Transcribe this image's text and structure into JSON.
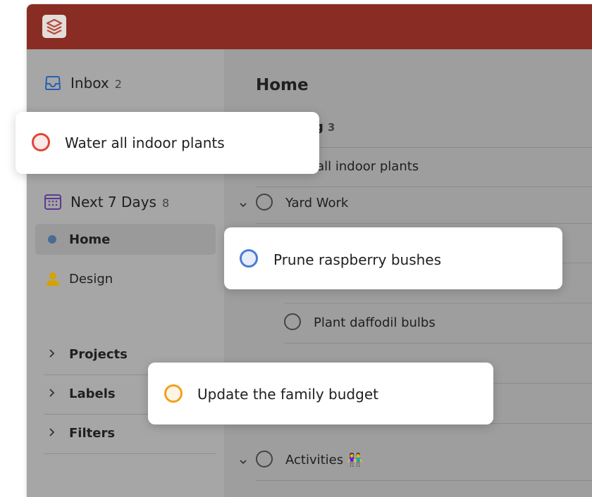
{
  "sidebar": {
    "filters": [
      {
        "label": "Inbox",
        "count": "2"
      },
      {
        "label": "Next 7 Days",
        "count": "8"
      }
    ],
    "projects": [
      {
        "label": "Home",
        "selected": true,
        "color": "#4a6c94"
      },
      {
        "label": "Design",
        "selected": false,
        "color": "#e2b203"
      }
    ],
    "sections": [
      "Projects",
      "Labels",
      "Filters"
    ]
  },
  "main": {
    "title": "Home",
    "sections": [
      {
        "label_tail": "g",
        "count": "3"
      }
    ],
    "rows": [
      {
        "label": "r all indoor plants"
      },
      {
        "label": "Yard Work"
      },
      {
        "label": "Plant daffodil bulbs"
      },
      {
        "label": "Activities 👫"
      }
    ]
  },
  "popups": [
    {
      "label": "Water all indoor plants",
      "color": "#e04538"
    },
    {
      "label": "Prune raspberry bushes",
      "color": "#4a7bd6"
    },
    {
      "label": "Update the family budget",
      "color": "#f0a020"
    }
  ],
  "colors": {
    "topbar": "#892c23",
    "accent_red": "#e04538",
    "accent_blue": "#4a7bd6",
    "accent_orange": "#f0a020"
  }
}
